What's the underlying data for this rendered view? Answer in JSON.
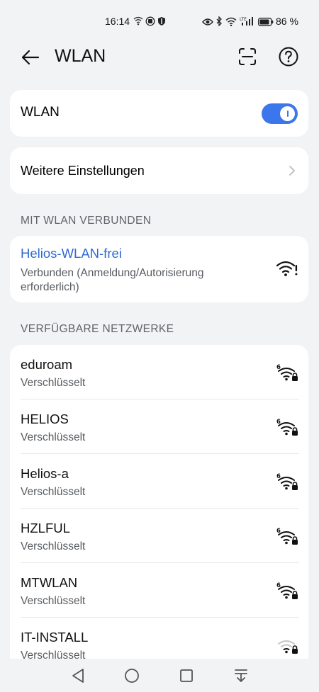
{
  "status_bar": {
    "time": "16:14",
    "battery_text": "86 %",
    "icons_left": [
      "wifi-hotspot-icon",
      "assistant-icon",
      "shield-icon"
    ],
    "icons_right": [
      "eye-icon",
      "bluetooth-icon",
      "wifi-signal-icon",
      "lte-signal-icon",
      "battery-icon"
    ]
  },
  "header": {
    "title": "WLAN",
    "icons": [
      "back-arrow-icon",
      "scan-icon",
      "help-icon"
    ]
  },
  "wlan_toggle": {
    "label": "WLAN",
    "state": "on",
    "accent_color": "#3b76ec"
  },
  "more_settings": {
    "label": "Weitere Einstellungen"
  },
  "connected_section": {
    "header": "MIT WLAN VERBUNDEN",
    "network": {
      "name": "Helios-WLAN-frei",
      "status": "Verbunden (Anmeldung/Autorisierung erforderlich)",
      "name_color": "#2d6ad6"
    }
  },
  "available_section": {
    "header": "VERFÜGBARE NETZWERKE",
    "networks": [
      {
        "name": "eduroam",
        "security": "Verschlüsselt",
        "signal": "strong"
      },
      {
        "name": "HELIOS",
        "security": "Verschlüsselt",
        "signal": "strong"
      },
      {
        "name": "Helios-a",
        "security": "Verschlüsselt",
        "signal": "strong"
      },
      {
        "name": "HZLFUL",
        "security": "Verschlüsselt",
        "signal": "strong"
      },
      {
        "name": "MTWLAN",
        "security": "Verschlüsselt",
        "signal": "strong"
      },
      {
        "name": "IT-INSTALL",
        "security": "Verschlüsselt",
        "signal": "weak"
      }
    ]
  },
  "nav_bar": {
    "icons": [
      "nav-back-icon",
      "nav-home-icon",
      "nav-recents-icon",
      "nav-notifications-icon"
    ]
  }
}
